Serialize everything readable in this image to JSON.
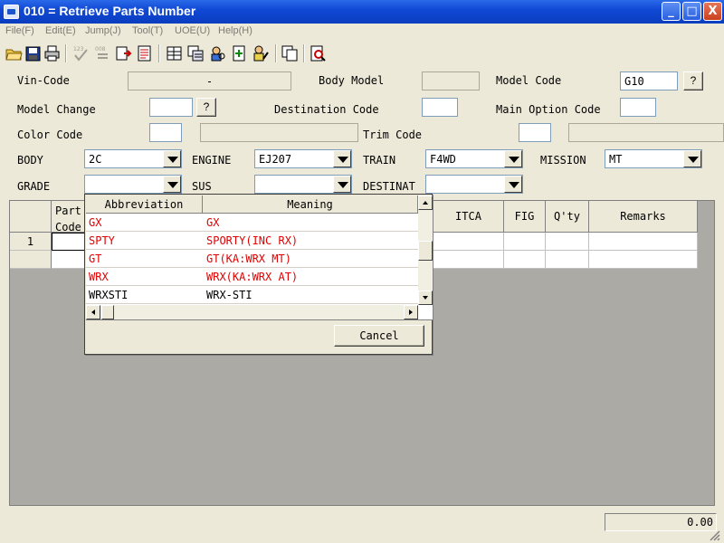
{
  "window": {
    "title": "010 = Retrieve Parts Number",
    "min_glyph": "_",
    "max_glyph": "□",
    "close_glyph": "X"
  },
  "menu": [
    "File(F)",
    "Edit(E)",
    "Jump(J)",
    "Tool(T)",
    "UOE(U)",
    "Help(H)"
  ],
  "toolbar": {
    "icons": [
      "open-folder-icon",
      "save-icon",
      "print-icon",
      "number-check-icon",
      "number-sequence-icon",
      "export-icon",
      "report-icon",
      "table-icon",
      "copy-table-icon",
      "user-search-icon",
      "document-add-icon",
      "person-edit-icon",
      "copy-window-icon",
      "search-document-icon"
    ],
    "num_label_1": "123",
    "num_label_2": "008"
  },
  "form": {
    "vin_code_label": "Vin-Code",
    "vin_code_value": "-",
    "body_model_label": "Body Model",
    "body_model_value": "",
    "model_code_label": "Model Code",
    "model_code_value": "G10",
    "model_change_label": "Model Change",
    "model_change_value": "",
    "destination_code_label": "Destination Code",
    "destination_code_value": "",
    "main_option_code_label": "Main Option Code",
    "main_option_code_value": "",
    "color_code_label": "Color Code",
    "color_code_value": "",
    "color_desc_value": "",
    "trim_code_label": "Trim Code",
    "trim_code_value": "",
    "trim_desc_value": "",
    "question_label": "?",
    "body_label": "BODY",
    "body_value": "2C",
    "engine_label": "ENGINE",
    "engine_value": "EJ207",
    "train_label": "TRAIN",
    "train_value": "F4WD",
    "mission_label": "MISSION",
    "mission_value": "MT",
    "grade_label": "GRADE",
    "grade_value": "",
    "sus_label": "SUS",
    "sus_value": "",
    "destinat_label": "DESTINAT",
    "destinat_value": ""
  },
  "grid": {
    "part_code_header_1": "Part",
    "part_code_header_2": "Code",
    "columns": [
      "ITCA",
      "FIG",
      "Q'ty",
      "Remarks"
    ],
    "row_number": "1"
  },
  "popup": {
    "columns": [
      "Abbreviation",
      "Meaning"
    ],
    "rows": [
      {
        "abbr": "GX",
        "meaning": "GX"
      },
      {
        "abbr": "SPTY",
        "meaning": "SPORTY(INC RX)"
      },
      {
        "abbr": "GT",
        "meaning": "GT(KA:WRX MT)"
      },
      {
        "abbr": "WRX",
        "meaning": "WRX(KA:WRX AT)"
      },
      {
        "abbr": "WRXSTI",
        "meaning": "WRX-STI"
      }
    ],
    "cancel_label": "Cancel",
    "colors": {
      "highlight": "#e00000",
      "normal": "#000000"
    }
  },
  "status": {
    "total_value": "0.00"
  }
}
